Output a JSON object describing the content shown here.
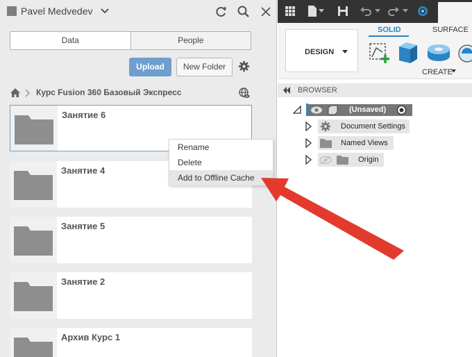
{
  "data_panel": {
    "user_name": "Pavel Medvedev",
    "tabs": [
      {
        "label": "Data"
      },
      {
        "label": "People"
      }
    ],
    "upload_label": "Upload",
    "new_folder_label": "New Folder",
    "breadcrumb_title": "Курс Fusion 360 Базовый Экспресс",
    "items": [
      {
        "name": "Занятие 6"
      },
      {
        "name": "Занятие 4"
      },
      {
        "name": "Занятие 5"
      },
      {
        "name": "Занятие 2"
      },
      {
        "name": "Архив Курс 1"
      }
    ]
  },
  "context_menu": {
    "items": [
      {
        "label": "Rename"
      },
      {
        "label": "Delete"
      },
      {
        "label": "Add to Offline Cache"
      }
    ]
  },
  "toolbar": {
    "icons": [
      "grid-icon",
      "file-icon",
      "save-icon",
      "undo-icon",
      "redo-icon",
      "fusion-logo-icon"
    ]
  },
  "ribbon": {
    "workspace_label": "DESIGN",
    "tabs": [
      {
        "label": "SOLID"
      },
      {
        "label": "SURFACE"
      }
    ],
    "create_label": "CREATE"
  },
  "browser": {
    "title": "BROWSER",
    "root_label": "(Unsaved)",
    "nodes": [
      {
        "label": "Document Settings"
      },
      {
        "label": "Named Views"
      },
      {
        "label": "Origin"
      }
    ]
  },
  "colors": {
    "accent_blue": "#6e9fcf",
    "tab_blue": "#2a84c6",
    "annotation_arrow": "#e23b2e"
  }
}
